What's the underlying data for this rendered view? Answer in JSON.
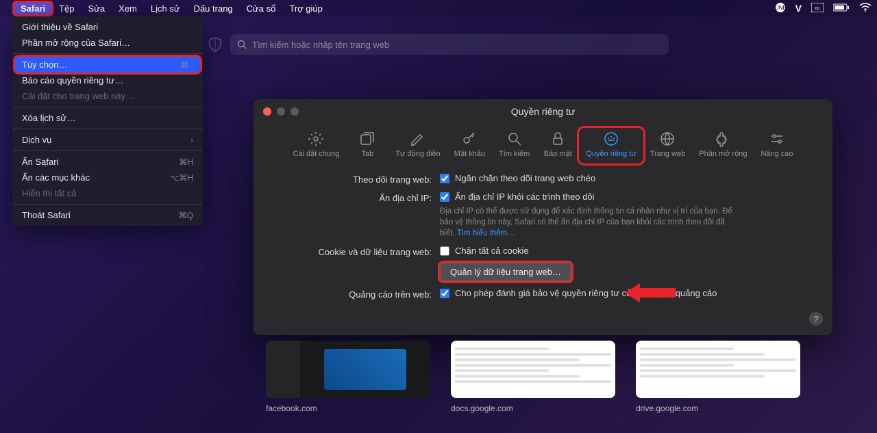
{
  "menubar": {
    "apple": "",
    "items": [
      "Safari",
      "Tệp",
      "Sửa",
      "Xem",
      "Lịch sử",
      "Dấu trang",
      "Cửa sổ",
      "Trợ giúp"
    ],
    "right_icons": [
      "line-icon",
      "v-icon",
      "cc-icon",
      "battery-icon",
      "wifi-icon"
    ]
  },
  "dropdown": {
    "items": [
      {
        "label": "Giới thiệu về Safari",
        "sc": "",
        "type": "item"
      },
      {
        "label": "Phần mở rộng của Safari…",
        "sc": "",
        "type": "item"
      },
      {
        "type": "sep"
      },
      {
        "label": "Tùy chọn…",
        "sc": "⌘ ,",
        "type": "hl"
      },
      {
        "label": "Báo cáo quyền riêng tư…",
        "sc": "",
        "type": "item"
      },
      {
        "label": "Cài đặt cho trang web này…",
        "sc": "",
        "type": "disabled"
      },
      {
        "type": "sep"
      },
      {
        "label": "Xóa lịch sử…",
        "sc": "",
        "type": "item"
      },
      {
        "type": "sep"
      },
      {
        "label": "Dịch vụ",
        "sc": "›",
        "type": "item"
      },
      {
        "type": "sep"
      },
      {
        "label": "Ẩn Safari",
        "sc": "⌘H",
        "type": "item"
      },
      {
        "label": "Ẩn các mục khác",
        "sc": "⌥⌘H",
        "type": "item"
      },
      {
        "label": "Hiển thị tất cả",
        "sc": "",
        "type": "disabled"
      },
      {
        "type": "sep"
      },
      {
        "label": "Thoát Safari",
        "sc": "⌘Q",
        "type": "item"
      }
    ]
  },
  "search": {
    "placeholder": "Tìm kiếm hoặc nhập tên trang web"
  },
  "prefs": {
    "title": "Quyền riêng tư",
    "tabs": [
      {
        "label": "Cài đặt chung"
      },
      {
        "label": "Tab"
      },
      {
        "label": "Tự động điền"
      },
      {
        "label": "Mật khẩu"
      },
      {
        "label": "Tìm kiếm"
      },
      {
        "label": "Bảo mật"
      },
      {
        "label": "Quyền riêng tư"
      },
      {
        "label": "Trang web"
      },
      {
        "label": "Phần mở rộng"
      },
      {
        "label": "Nâng cao"
      }
    ],
    "rows": {
      "tracking": {
        "label": "Theo dõi trang web:",
        "check": "Ngăn chặn theo dõi trang web chéo"
      },
      "ip": {
        "label": "Ẩn địa chỉ IP:",
        "check": "Ẩn địa chỉ IP khỏi các trình theo dõi",
        "hint": "Địa chỉ IP có thể được sử dụng để xác định thông tin cá nhân như vị trí của bạn. Để bảo vệ thông tin này, Safari có thể ẩn địa chỉ IP của bạn khỏi các trình theo dõi đã biết.",
        "link": "Tìm hiểu thêm…"
      },
      "cookie": {
        "label": "Cookie và dữ liệu trang web:",
        "check": "Chặn tất cả cookie",
        "button": "Quản lý dữ liệu trang web…"
      },
      "ads": {
        "label": "Quảng cáo trên web:",
        "check": "Cho phép đánh giá bảo vệ quyền riêng tư của hiệu quả quảng cáo"
      }
    },
    "help": "?"
  },
  "thumbs": [
    {
      "label": "facebook.com"
    },
    {
      "label": "docs.google.com"
    },
    {
      "label": "drive.google.com"
    }
  ]
}
